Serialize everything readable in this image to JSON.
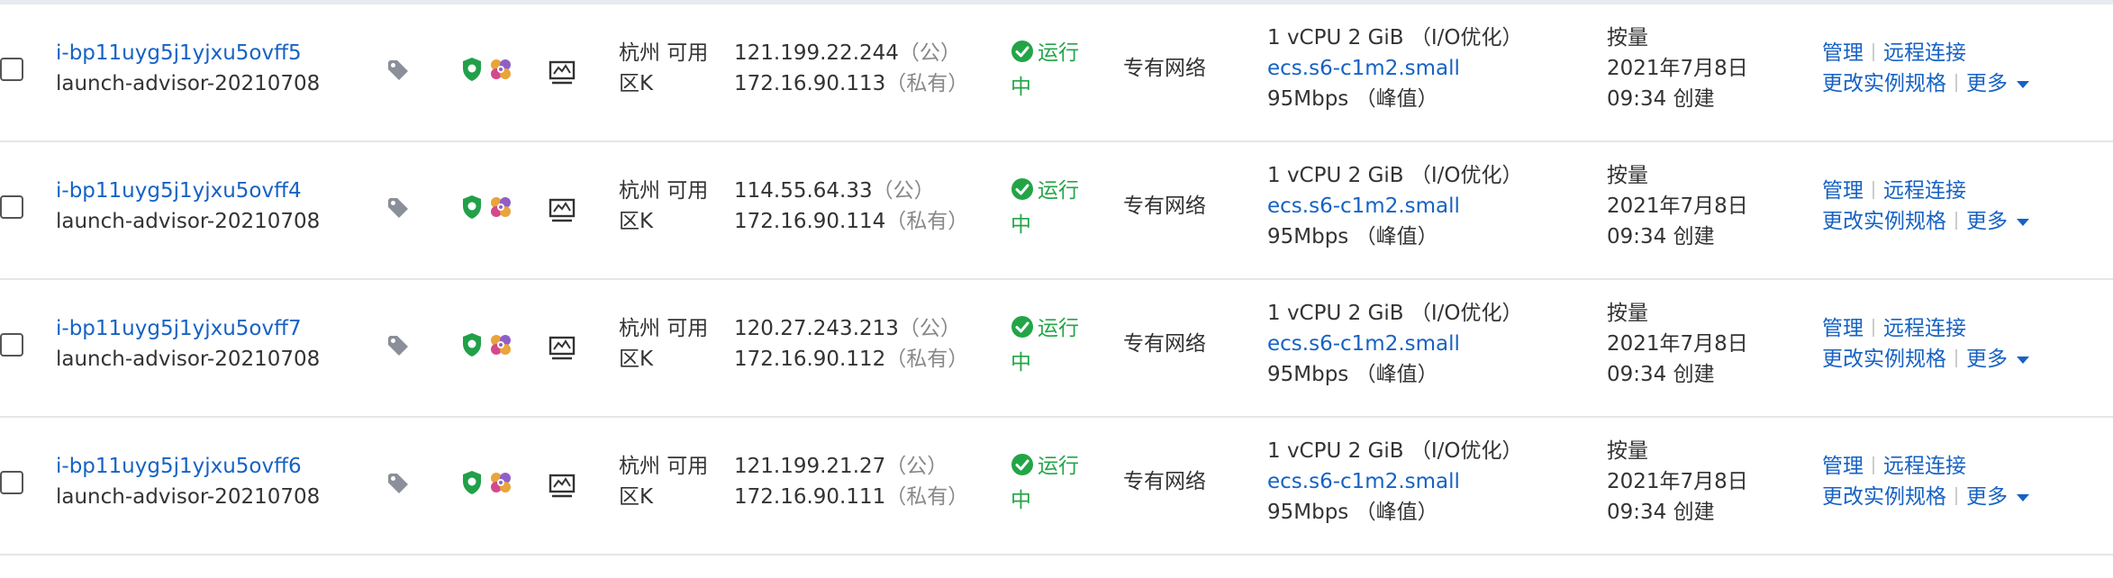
{
  "rows": [
    {
      "instance_id": "i-bp11uyg5j1yjxu5ovff5",
      "instance_name": "launch-advisor-20210708",
      "zone_line1": "杭州 可用",
      "zone_line2": "区K",
      "public_ip": "121.199.22.244",
      "public_tag": "（公）",
      "private_ip": "172.16.90.113",
      "private_tag": "（私有）",
      "status_line1": "运行",
      "status_line2": "中",
      "network": "专有网络",
      "spec_line1": "1 vCPU 2 GiB （I/O优化）",
      "spec_type": "ecs.s6-c1m2.small",
      "spec_bandwidth": "95Mbps （峰值）",
      "billing_line1": "按量",
      "billing_line2": "2021年7月8日",
      "billing_line3": "09:34 创建",
      "op_manage": "管理",
      "op_remote": "远程连接",
      "op_change_spec": "更改实例规格",
      "op_more": "更多"
    },
    {
      "instance_id": "i-bp11uyg5j1yjxu5ovff4",
      "instance_name": "launch-advisor-20210708",
      "zone_line1": "杭州 可用",
      "zone_line2": "区K",
      "public_ip": "114.55.64.33",
      "public_tag": "（公）",
      "private_ip": "172.16.90.114",
      "private_tag": "（私有）",
      "status_line1": "运行",
      "status_line2": "中",
      "network": "专有网络",
      "spec_line1": "1 vCPU 2 GiB （I/O优化）",
      "spec_type": "ecs.s6-c1m2.small",
      "spec_bandwidth": "95Mbps （峰值）",
      "billing_line1": "按量",
      "billing_line2": "2021年7月8日",
      "billing_line3": "09:34 创建",
      "op_manage": "管理",
      "op_remote": "远程连接",
      "op_change_spec": "更改实例规格",
      "op_more": "更多"
    },
    {
      "instance_id": "i-bp11uyg5j1yjxu5ovff7",
      "instance_name": "launch-advisor-20210708",
      "zone_line1": "杭州 可用",
      "zone_line2": "区K",
      "public_ip": "120.27.243.213",
      "public_tag": "（公）",
      "private_ip": "172.16.90.112",
      "private_tag": "（私有）",
      "status_line1": "运行",
      "status_line2": "中",
      "network": "专有网络",
      "spec_line1": "1 vCPU 2 GiB （I/O优化）",
      "spec_type": "ecs.s6-c1m2.small",
      "spec_bandwidth": "95Mbps （峰值）",
      "billing_line1": "按量",
      "billing_line2": "2021年7月8日",
      "billing_line3": "09:34 创建",
      "op_manage": "管理",
      "op_remote": "远程连接",
      "op_change_spec": "更改实例规格",
      "op_more": "更多"
    },
    {
      "instance_id": "i-bp11uyg5j1yjxu5ovff6",
      "instance_name": "launch-advisor-20210708",
      "zone_line1": "杭州 可用",
      "zone_line2": "区K",
      "public_ip": "121.199.21.27",
      "public_tag": "（公）",
      "private_ip": "172.16.90.111",
      "private_tag": "（私有）",
      "status_line1": "运行",
      "status_line2": "中",
      "network": "专有网络",
      "spec_line1": "1 vCPU 2 GiB （I/O优化）",
      "spec_type": "ecs.s6-c1m2.small",
      "spec_bandwidth": "95Mbps （峰值）",
      "billing_line1": "按量",
      "billing_line2": "2021年7月8日",
      "billing_line3": "09:34 创建",
      "op_manage": "管理",
      "op_remote": "远程连接",
      "op_change_spec": "更改实例规格",
      "op_more": "更多"
    }
  ],
  "icons": {
    "tag": "tag-icon",
    "security": "shield-icon",
    "app": "app-badge-icon",
    "monitor": "monitor-icon",
    "status": "check-circle-icon",
    "more": "caret-down-icon"
  },
  "colors": {
    "link": "#1662c4",
    "status_running": "#23a547",
    "muted": "#888888",
    "text": "#333333",
    "row_border": "#e6e6e6"
  }
}
